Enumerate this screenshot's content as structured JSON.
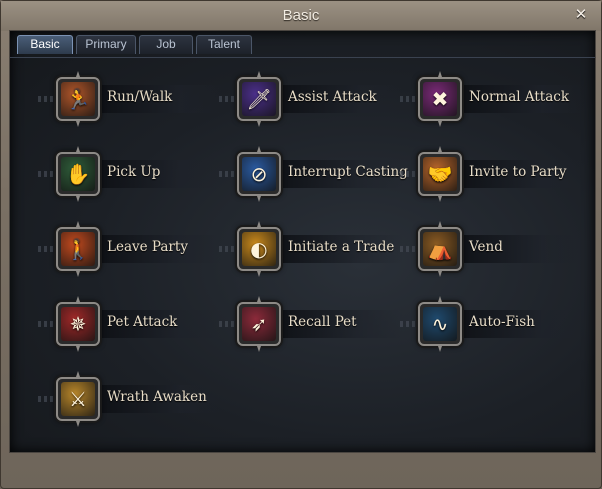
{
  "window": {
    "title": "Basic"
  },
  "tabs": [
    {
      "label": "Basic",
      "active": true
    },
    {
      "label": "Primary",
      "active": false
    },
    {
      "label": "Job",
      "active": false
    },
    {
      "label": "Talent",
      "active": false
    }
  ],
  "skills": [
    {
      "label": "Run/Walk",
      "icon": "running-icon",
      "color": "#b0562a"
    },
    {
      "label": "Assist Attack",
      "icon": "sword-icon",
      "color": "#4b2f8a"
    },
    {
      "label": "Normal Attack",
      "icon": "crossed-swords-icon",
      "color": "#7b2a78"
    },
    {
      "label": "Pick Up",
      "icon": "hand-icon",
      "color": "#2f5d3a"
    },
    {
      "label": "Interrupt Casting",
      "icon": "broken-circle-icon",
      "color": "#2a5aa0"
    },
    {
      "label": "Invite to Party",
      "icon": "handshake-icon",
      "color": "#b8652a"
    },
    {
      "label": "Leave Party",
      "icon": "walking-away-icon",
      "color": "#c24a1e"
    },
    {
      "label": "Initiate a Trade",
      "icon": "coin-icon",
      "color": "#c9891c"
    },
    {
      "label": "Vend",
      "icon": "vendor-stall-icon",
      "color": "#8a5a22"
    },
    {
      "label": "Pet Attack",
      "icon": "claw-icon",
      "color": "#a02828"
    },
    {
      "label": "Recall Pet",
      "icon": "whistle-icon",
      "color": "#8c2a3a"
    },
    {
      "label": "Auto-Fish",
      "icon": "fishing-hook-icon",
      "color": "#1f4a6e"
    },
    {
      "label": "Wrath Awaken",
      "icon": "golden-swords-icon",
      "color": "#b8862a"
    }
  ],
  "icon_glyphs": {
    "running-icon": "🏃",
    "sword-icon": "🗡",
    "crossed-swords-icon": "✖",
    "hand-icon": "✋",
    "broken-circle-icon": "⊘",
    "handshake-icon": "🤝",
    "walking-away-icon": "🚶",
    "coin-icon": "◐",
    "vendor-stall-icon": "⛺",
    "claw-icon": "✵",
    "whistle-icon": "➶",
    "fishing-hook-icon": "∿",
    "golden-swords-icon": "⚔"
  }
}
